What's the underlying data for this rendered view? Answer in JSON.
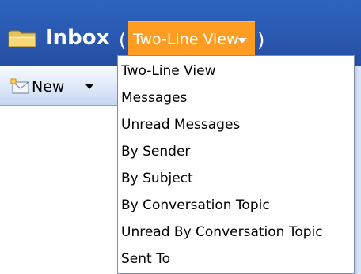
{
  "header": {
    "title": "Inbox",
    "paren_open": "(",
    "paren_close": ")",
    "view_dropdown_label": "Two-Line View",
    "accent_color": "#ff9d22",
    "background_color": "#2a59b0"
  },
  "toolbar": {
    "new_label": "New"
  },
  "view_menu": {
    "items": [
      {
        "label": "Two-Line View"
      },
      {
        "label": "Messages"
      },
      {
        "label": "Unread Messages"
      },
      {
        "label": "By Sender"
      },
      {
        "label": "By Subject"
      },
      {
        "label": "By Conversation Topic"
      },
      {
        "label": "Unread By Conversation Topic"
      },
      {
        "label": "Sent To"
      }
    ]
  },
  "icons": {
    "folder": "folder-icon",
    "new": "new-message-icon",
    "dropdown": "chevron-down-icon"
  }
}
